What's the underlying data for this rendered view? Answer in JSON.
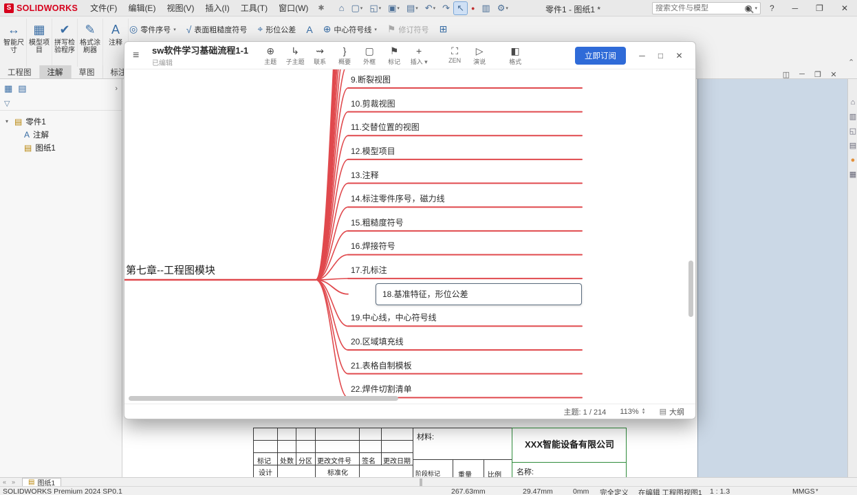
{
  "colors": {
    "accent_blue": "#2f6bd8",
    "branch_red": "#e0494d",
    "company_green": "#2e8b3a",
    "logo_red": "#d6001c"
  },
  "titlebar": {
    "logo_text": "SOLIDWORKS",
    "menus": [
      "文件(F)",
      "编辑(E)",
      "视图(V)",
      "插入(I)",
      "工具(T)",
      "窗口(W)"
    ],
    "quick_icons": [
      {
        "name": "home-icon",
        "glyph": "⌂"
      },
      {
        "name": "new-document-icon",
        "glyph": "▢",
        "dropdown": true
      },
      {
        "name": "open-icon",
        "glyph": "◱",
        "dropdown": true
      },
      {
        "name": "save-icon",
        "glyph": "▣",
        "dropdown": true
      },
      {
        "name": "print-icon",
        "glyph": "▤",
        "dropdown": true
      },
      {
        "name": "undo-icon",
        "glyph": "↶",
        "dropdown": true
      },
      {
        "name": "redo-icon",
        "glyph": "↷"
      },
      {
        "name": "select-arrow-icon",
        "glyph": "↖",
        "active": true
      },
      {
        "name": "rebuild-icon",
        "glyph": "●",
        "color": "#c03030"
      },
      {
        "name": "sheet-properties-icon",
        "glyph": "▥"
      },
      {
        "name": "options-gear-icon",
        "glyph": "⚙",
        "dropdown": true
      }
    ],
    "doc_title": "零件1 - 图纸1 *",
    "search_placeholder": "搜索文件与模型",
    "right_icons": [
      {
        "name": "user-account-icon",
        "glyph": "◉"
      },
      {
        "name": "help-icon",
        "glyph": "?"
      },
      {
        "name": "window-minimize-icon",
        "glyph": "─"
      },
      {
        "name": "window-maximize-icon",
        "glyph": "❐"
      },
      {
        "name": "window-close-icon",
        "glyph": "✕"
      }
    ]
  },
  "ribbon": {
    "big_buttons": [
      {
        "name": "smart-dimension-button",
        "icon": "smart-dimension-icon",
        "glyph": "↔",
        "label": "智能尺寸"
      },
      {
        "name": "model-items-button",
        "icon": "model-items-icon",
        "glyph": "▦",
        "label": "模型项目"
      },
      {
        "name": "spell-checker-button",
        "icon": "spell-checker-icon",
        "glyph": "✔",
        "label": "拼写检验程序"
      },
      {
        "name": "format-painter-button",
        "icon": "format-painter-icon",
        "glyph": "✎",
        "label": "格式涂刷器"
      },
      {
        "name": "note-button",
        "icon": "note-icon",
        "glyph": "A",
        "label": "注释"
      }
    ],
    "annotation_tools": [
      {
        "name": "balloon-button",
        "icon": "balloon-icon",
        "glyph": "◎",
        "label": "零件序号",
        "dropdown": true
      },
      {
        "name": "surface-finish-button",
        "icon": "surface-finish-icon",
        "glyph": "√",
        "label": "表面粗糙度符号"
      },
      {
        "name": "geometric-tolerance-button",
        "icon": "geometric-tolerance-icon",
        "glyph": "⌖",
        "label": "形位公差"
      },
      {
        "name": "datum-feature-button",
        "icon": "datum-feature-icon",
        "glyph": "A",
        "label": ""
      },
      {
        "name": "center-mark-button",
        "icon": "center-mark-icon",
        "glyph": "⊕",
        "label": "中心符号线",
        "dropdown": true
      },
      {
        "name": "revision-symbol-button",
        "icon": "revision-symbol-icon",
        "glyph": "⚑",
        "label": "修订符号",
        "disabled": true
      },
      {
        "name": "general-table-button",
        "icon": "table-icon",
        "glyph": "⊞",
        "label": ""
      }
    ],
    "tabs": [
      {
        "label": "工程图"
      },
      {
        "label": "注解",
        "active": true
      },
      {
        "label": "草图"
      },
      {
        "label": "标注"
      }
    ]
  },
  "left_panel": {
    "tab_icons": [
      {
        "name": "featuremanager-tab-icon",
        "glyph": "▦"
      },
      {
        "name": "displaymanager-tab-icon",
        "glyph": "▤"
      }
    ],
    "tree": [
      {
        "icon": "drawing-doc-icon",
        "glyph": "▤",
        "glyph_color": "#b8860b",
        "label": "零件1",
        "indent": 0,
        "expand": true
      },
      {
        "icon": "annotations-folder-icon",
        "glyph": "A",
        "glyph_color": "#3a6ea5",
        "label": "注解",
        "indent": 1
      },
      {
        "icon": "sheet-icon",
        "glyph": "▤",
        "glyph_color": "#b8860b",
        "label": "图纸1",
        "indent": 1
      }
    ]
  },
  "taskpane_icons": [
    {
      "name": "resources-home-icon",
      "glyph": "⌂"
    },
    {
      "name": "design-library-icon",
      "glyph": "▥"
    },
    {
      "name": "file-explorer-icon",
      "glyph": "◱"
    },
    {
      "name": "view-palette-icon",
      "glyph": "▤"
    },
    {
      "name": "appearances-icon",
      "glyph": "●",
      "color": "#e2903a"
    },
    {
      "name": "custom-properties-icon",
      "glyph": "▦"
    }
  ],
  "child_window_controls": [
    {
      "name": "dock-panel-icon",
      "glyph": "◫"
    },
    {
      "name": "child-minimize-icon",
      "glyph": "─"
    },
    {
      "name": "child-restore-icon",
      "glyph": "❐"
    },
    {
      "name": "child-close-icon",
      "glyph": "✕"
    }
  ],
  "mindmap": {
    "title": "sw软件学习基础流程1-1",
    "subtitle": "已编辑",
    "tools": [
      {
        "name": "topic-button",
        "icon": "topic-icon",
        "glyph": "⊕",
        "label": "主题"
      },
      {
        "name": "subtopic-button",
        "icon": "subtopic-icon",
        "glyph": "↳",
        "label": "子主题"
      },
      {
        "name": "relationship-button",
        "icon": "relationship-icon",
        "glyph": "⇝",
        "label": "联系"
      },
      {
        "name": "summary-button",
        "icon": "summary-icon",
        "glyph": "}",
        "label": "概要"
      },
      {
        "name": "boundary-button",
        "icon": "boundary-icon",
        "glyph": "▢",
        "label": "外框"
      },
      {
        "name": "marker-button",
        "icon": "marker-icon",
        "glyph": "⚑",
        "label": "标记"
      },
      {
        "name": "insert-button",
        "icon": "insert-icon",
        "glyph": "+",
        "label": "插入",
        "dropdown": true
      },
      {
        "name": "zen-mode-button",
        "icon": "zen-icon",
        "glyph": "⛶",
        "label": "ZEN",
        "group": true
      },
      {
        "name": "pitch-button",
        "icon": "play-icon",
        "glyph": "▷",
        "label": "演说"
      },
      {
        "name": "format-button",
        "icon": "format-panel-icon",
        "glyph": "◧",
        "label": "格式",
        "group": true
      }
    ],
    "subscribe_label": "立即订阅",
    "window_controls": [
      {
        "name": "mindmap-minimize-icon",
        "glyph": "─"
      },
      {
        "name": "mindmap-maximize-icon",
        "glyph": "□"
      },
      {
        "name": "mindmap-close-icon",
        "glyph": "✕"
      }
    ],
    "canvas": {
      "root_topic": "第七章--工程图模块",
      "topics": [
        "9.断裂视图",
        "10.剪裁视图",
        "11.交替位置的视图",
        "12.模型项目",
        "13.注释",
        "14.标注零件序号，磁力线",
        "15.粗糙度符号",
        "16.焊接符号",
        "17.孔标注",
        "18.基准特征，形位公差",
        "19.中心线，中心符号线",
        "20.区域填充线",
        "21.表格自制模板",
        "22.焊件切割清单"
      ],
      "selected": "18.基准特征，形位公差"
    },
    "status": {
      "topics": "主题: 1 / 214",
      "zoom": "113%",
      "outline": "大纲"
    }
  },
  "title_block": {
    "material_label": "材料:",
    "company": "XXX智能设备有限公司",
    "name_label": "名称:",
    "change_row": [
      "标记",
      "处数",
      "分区",
      "更改文件号",
      "签名",
      "更改日期"
    ],
    "design_label": "设计",
    "standardization_label": "标准化",
    "stage_label": "阶段标记",
    "weight_label": "重量",
    "scale_label": "比例"
  },
  "sheet_tabs": {
    "tabs": [
      "图纸1"
    ]
  },
  "statusbar": {
    "product": "SOLIDWORKS Premium 2024 SP0.1",
    "x": "267.63mm",
    "y": "29.47mm",
    "z": "0mm",
    "define_state": "完全定义",
    "editing": "在编辑 工程图视图1",
    "sheet_scale": "1 : 1.3",
    "units": "MMGS"
  }
}
